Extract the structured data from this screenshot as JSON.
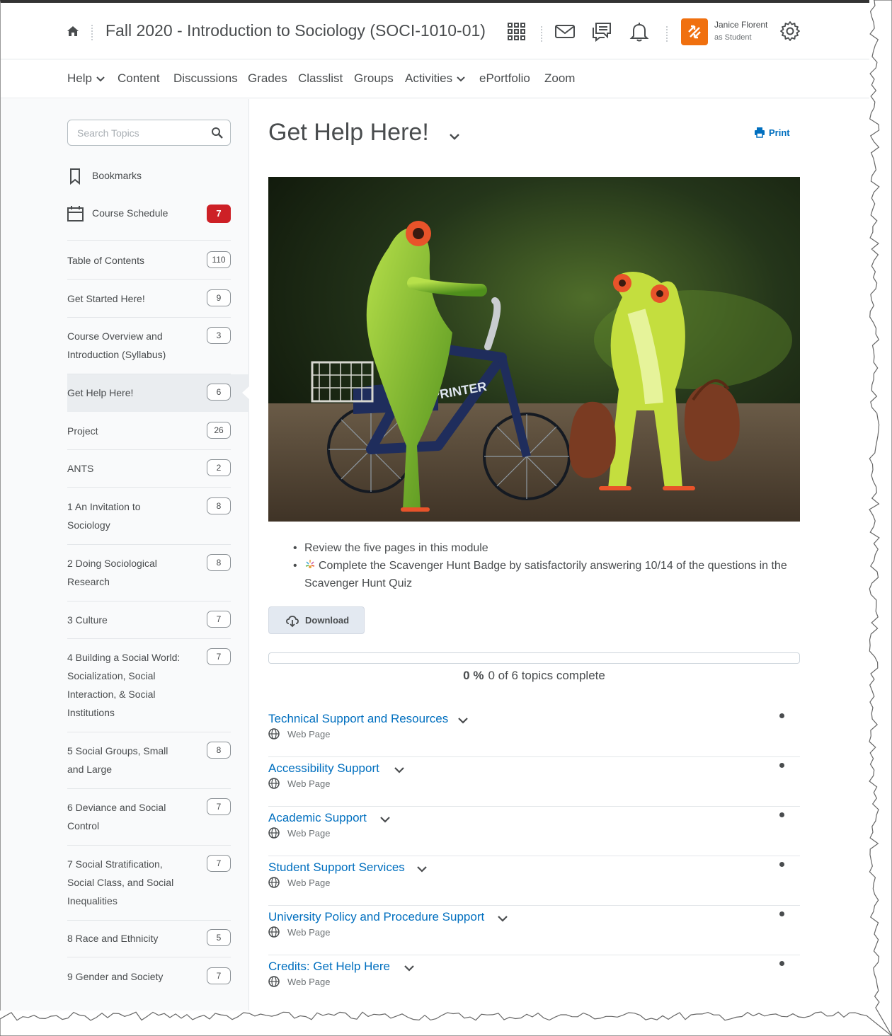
{
  "header": {
    "course_title": "Fall 2020 - Introduction to Sociology (SOCI-1010-01)",
    "user_name": "Janice Florent",
    "user_role": "as Student",
    "icons": [
      "home-icon",
      "app-grid-icon",
      "mail-icon",
      "chat-icon",
      "bell-icon",
      "gear-icon"
    ],
    "accent": "#f0700f"
  },
  "nav": {
    "items": [
      {
        "label": "Help",
        "dropdown": true
      },
      {
        "label": "Content"
      },
      {
        "label": "Discussions"
      },
      {
        "label": "Grades"
      },
      {
        "label": "Classlist"
      },
      {
        "label": "Groups"
      },
      {
        "label": "Activities",
        "dropdown": true
      },
      {
        "label": "ePortfolio"
      },
      {
        "label": "Zoom"
      }
    ]
  },
  "sidebar": {
    "search_placeholder": "Search Topics",
    "bookmarks": "Bookmarks",
    "schedule": {
      "label": "Course Schedule",
      "badge": "7"
    },
    "modules": [
      {
        "label": "Table of Contents",
        "count": "110"
      },
      {
        "label": "Get Started Here!",
        "count": "9"
      },
      {
        "label": "Course Overview and Introduction (Syllabus)",
        "count": "3"
      },
      {
        "label": "Get Help Here!",
        "count": "6",
        "active": true
      },
      {
        "label": "Project",
        "count": "26"
      },
      {
        "label": "ANTS",
        "count": "2"
      },
      {
        "label": "1 An Invitation to Sociology",
        "count": "8"
      },
      {
        "label": "2 Doing Sociological Research",
        "count": "8"
      },
      {
        "label": "3 Culture",
        "count": "7"
      },
      {
        "label": "4 Building a Social World: Socialization, Social Interaction, & Social Institutions",
        "count": "7"
      },
      {
        "label": "5 Social Groups, Small and Large",
        "count": "8"
      },
      {
        "label": "6 Deviance and Social Control",
        "count": "7"
      },
      {
        "label": "7 Social Stratification, Social Class, and Social Inequalities",
        "count": "7"
      },
      {
        "label": "8 Race and Ethnicity",
        "count": "5"
      },
      {
        "label": "9 Gender and Society",
        "count": "7"
      }
    ]
  },
  "main": {
    "title": "Get Help Here!",
    "print_label": "Print",
    "hero_text": "SPRINTER",
    "bullets": [
      "Review the five pages in this module",
      "Complete the Scavenger Hunt Badge by satisfactorily answering 10/14 of the questions in the Scavenger Hunt Quiz"
    ],
    "download_label": "Download",
    "progress": {
      "percent_value": 0,
      "percent": "0 %",
      "text": "0 of 6 topics complete"
    },
    "topics": [
      {
        "title": "Technical Support and Resources",
        "type": "Web Page"
      },
      {
        "title": "Accessibility Support",
        "type": "Web Page"
      },
      {
        "title": "Academic Support",
        "type": "Web Page"
      },
      {
        "title": "Student Support Services",
        "type": "Web Page"
      },
      {
        "title": "University Policy and Procedure Support",
        "type": "Web Page"
      },
      {
        "title": "Credits: Get Help Here",
        "type": "Web Page"
      }
    ],
    "link_color": "#006fbf",
    "badge_color": "#cd2026"
  }
}
